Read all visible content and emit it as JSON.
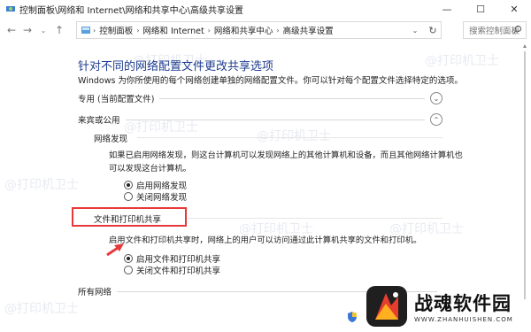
{
  "window": {
    "title": "控制面板\\网络和 Internet\\网络和共享中心\\高级共享设置",
    "minimize": "—",
    "maximize": "☐",
    "close": "✕"
  },
  "address": {
    "crumbs": [
      "控制面板",
      "网络和 Internet",
      "网络和共享中心",
      "高级共享设置"
    ],
    "sep": "›",
    "search_placeholder": "搜索控制面板"
  },
  "page": {
    "heading": "针对不同的网络配置文件更改共享选项",
    "description": "Windows 为你所使用的每个网络创建单独的网络配置文件。你可以针对每个配置文件选择特定的选项。"
  },
  "sections": {
    "private": "专用 (当前配置文件)",
    "guest_public": "来宾或公用",
    "all_networks": "所有网络"
  },
  "network_discovery": {
    "title": "网络发现",
    "description_line1": "如果已启用网络发现，则这台计算机可以发现网络上的其他计算机和设备，而且其他网络计算机也",
    "description_line2": "可以发现这台计算机。",
    "option_on": "启用网络发现",
    "option_off": "关闭网络发现",
    "selected": "on"
  },
  "file_printer": {
    "title": "文件和打印机共享",
    "description": "启用文件和打印机共享时，网络上的用户可以访问通过此计算机共享的文件和打印机。",
    "option_on": "启用文件和打印机共享",
    "option_off": "关闭文件和打印机共享",
    "selected": "on"
  },
  "watermark": "@打印机卫士",
  "logo": {
    "cn": "战魂软件园",
    "en": "WWW.ZHANHUISHEN.COM"
  },
  "colors": {
    "heading": "#1e3d8f",
    "highlight": "#e8393a"
  }
}
